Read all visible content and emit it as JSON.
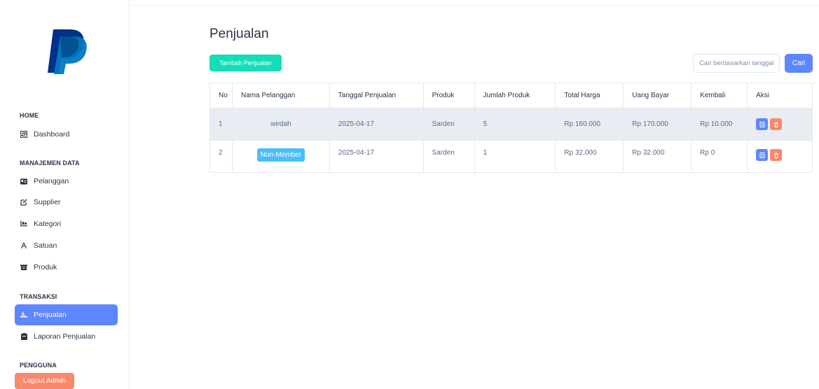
{
  "sidebar": {
    "sections": {
      "home": "HOME",
      "manajemen": "MANAJEMEN DATA",
      "transaksi": "TRANSAKSI",
      "pengguna": "PENGGUNA"
    },
    "items": {
      "dashboard": "Dashboard",
      "pelanggan": "Pelanggan",
      "supplier": "Supplier",
      "kategori": "Kategori",
      "satuan": "Satuan",
      "produk": "Produk",
      "penjualan": "Penjualan",
      "laporan": "Laporan Penjualan"
    },
    "logout_label": "Logout Admin"
  },
  "main": {
    "title": "Penjualan",
    "add_button": "Tambah Penjualan",
    "search_placeholder": "Cari berdasarkan tanggal",
    "search_button": "Cari",
    "columns": [
      "No",
      "Nama Pelanggan",
      "Tanggal Penjualan",
      "Produk",
      "Jumlah Produk",
      "Total Harga",
      "Uang Bayar",
      "Kembali",
      "Aksi"
    ],
    "rows": [
      {
        "no": "1",
        "pelanggan": "wirdah",
        "tanggal": "2025-04-17",
        "produk": "Sarden",
        "jumlah": "5",
        "total": "Rp 160.000",
        "bayar": "Rp 170.000",
        "kembali": "Rp 10.000"
      },
      {
        "no": "2",
        "pelanggan": "Non-Member",
        "tanggal": "2025-04-17",
        "produk": "Sarden",
        "jumlah": "1",
        "total": "Rp 32.000",
        "bayar": "Rp 32.000",
        "kembali": "Rp 0"
      }
    ]
  },
  "colors": {
    "primary": "#5d87ff",
    "success": "#13deb9",
    "danger": "#fa896b",
    "info": "#49beff"
  },
  "icons": {
    "logo": "paypal-logo",
    "dashboard": "layout-grid-icon",
    "pelanggan": "id-card-icon",
    "supplier": "edit-icon",
    "kategori": "truck-loading-icon",
    "satuan": "ruler-icon",
    "produk": "box-icon",
    "penjualan": "cash-icon",
    "laporan": "clipboard-icon",
    "edit_action": "note-icon",
    "delete_action": "trash-icon"
  }
}
